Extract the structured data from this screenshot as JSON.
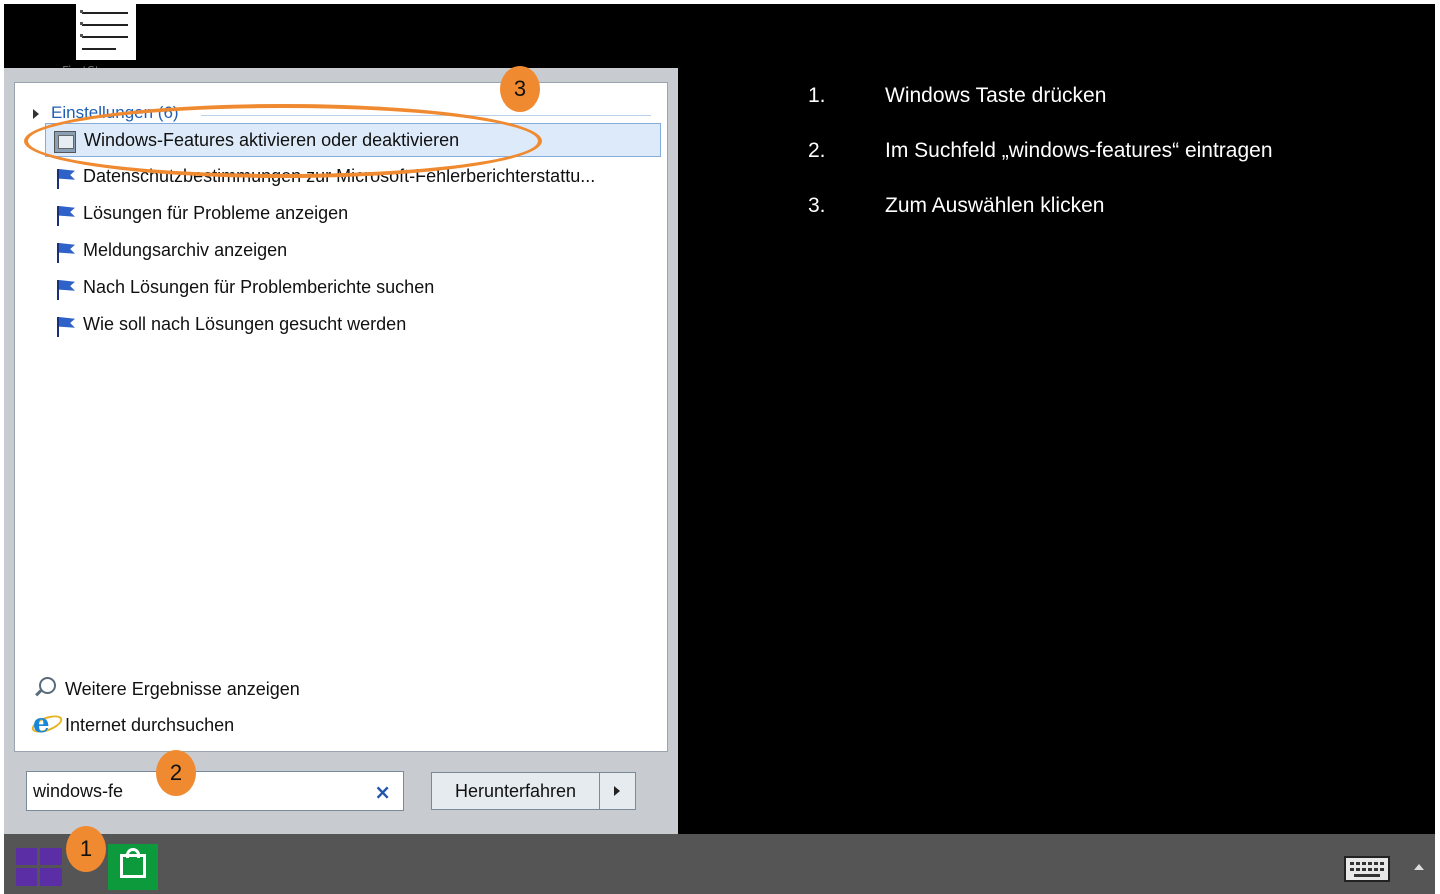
{
  "desktop": {
    "icon_label": "FirstSteps"
  },
  "start_menu": {
    "section": {
      "title": "Einstellungen (6)"
    },
    "results": [
      {
        "label": "Windows-Features aktivieren oder deaktivieren",
        "icon": "windows-features-icon",
        "selected": true
      },
      {
        "label": "Datenschutzbestimmungen zur Microsoft-Fehlerberichterstattu...",
        "icon": "flag-icon"
      },
      {
        "label": "Lösungen für Probleme anzeigen",
        "icon": "flag-icon"
      },
      {
        "label": "Meldungsarchiv anzeigen",
        "icon": "flag-icon"
      },
      {
        "label": "Nach Lösungen für Problemberichte suchen",
        "icon": "flag-icon"
      },
      {
        "label": "Wie soll nach Lösungen gesucht werden",
        "icon": "flag-icon"
      }
    ],
    "more_results": "Weitere Ergebnisse anzeigen",
    "web_search": "Internet durchsuchen",
    "search": {
      "value": "windows-fe"
    },
    "shutdown_label": "Herunterfahren"
  },
  "instructions": [
    {
      "number": "1.",
      "text": "Windows Taste drücken"
    },
    {
      "number": "2.",
      "text": "Im Suchfeld „windows-features“ eintragen"
    },
    {
      "number": "3.",
      "text": "Zum Auswählen klicken"
    }
  ],
  "annotations": {
    "badge_1": "1",
    "badge_2": "2",
    "badge_3": "3",
    "accent_color": "#f08a30"
  },
  "taskbar": {
    "start_icon": "windows-logo-icon",
    "store_icon": "store-icon",
    "tray_icons": [
      "keyboard-icon",
      "show-hidden-icons-arrow"
    ]
  }
}
